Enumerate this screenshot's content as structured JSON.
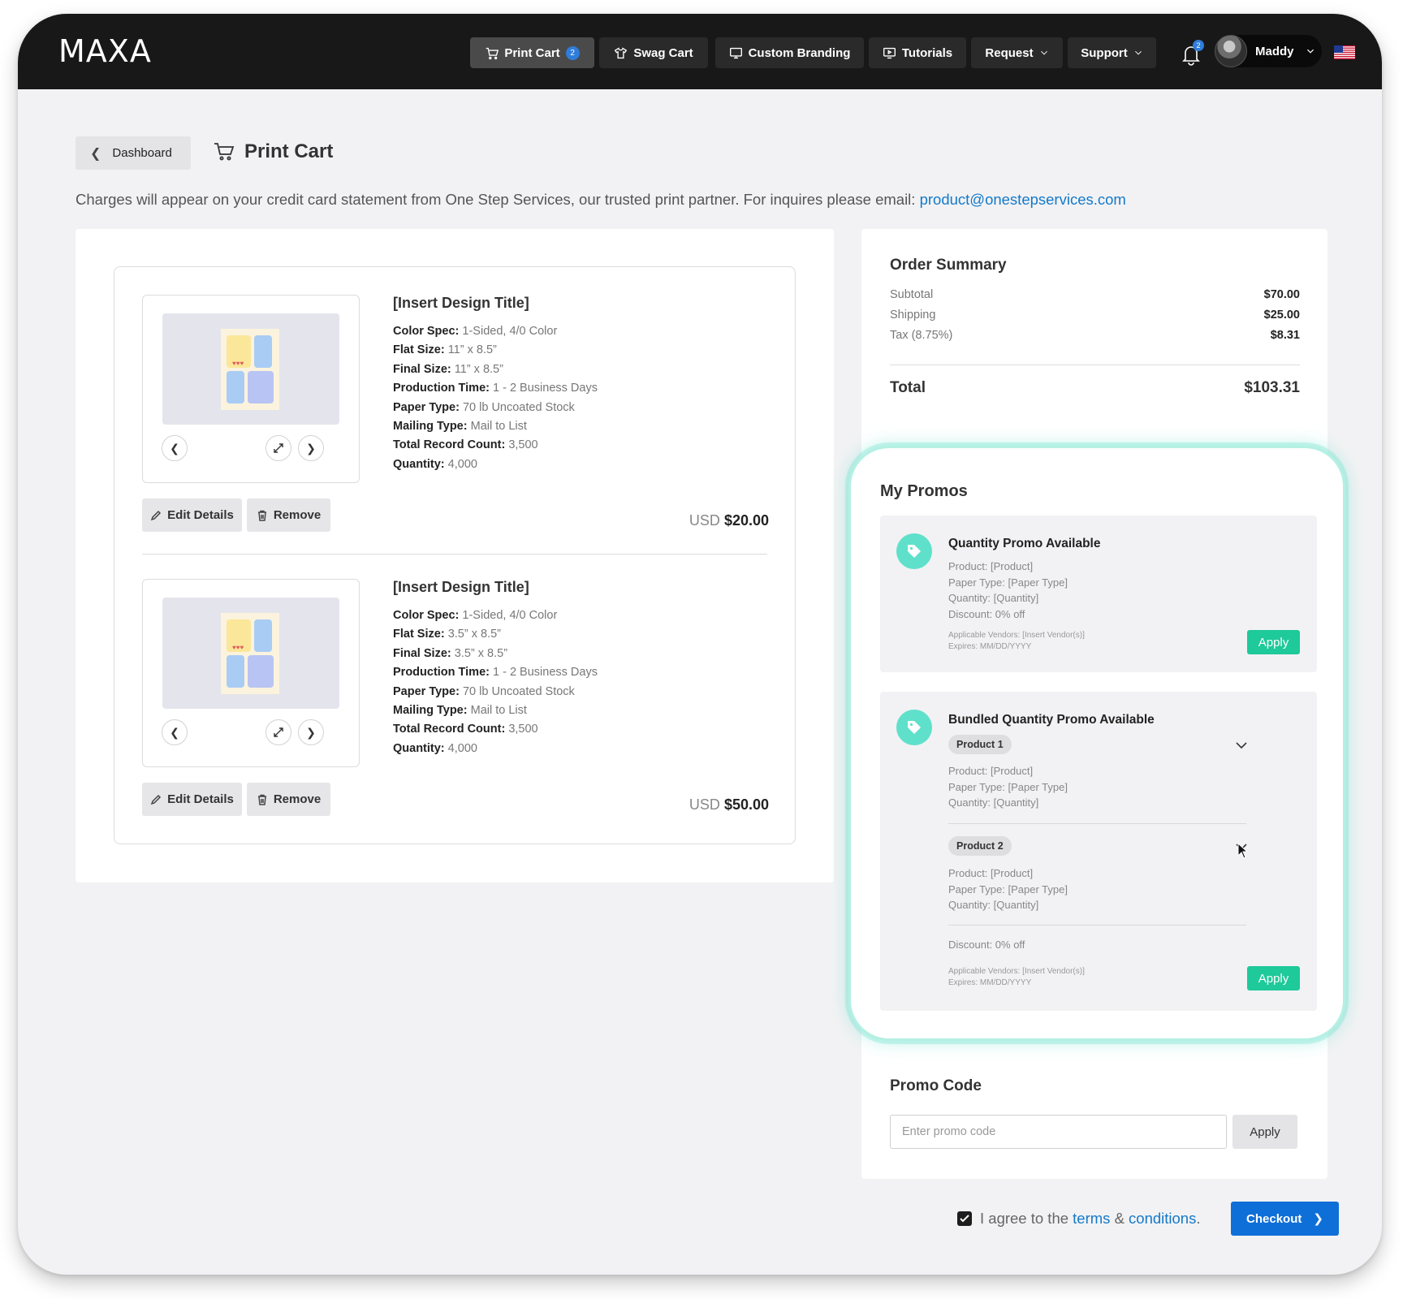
{
  "nav": {
    "logo": "MAXA",
    "items": [
      {
        "label": "Print Cart",
        "badge": "2",
        "icon": "cart-icon",
        "active": true
      },
      {
        "label": "Swag Cart",
        "icon": "shirt-icon"
      },
      {
        "label": "Custom Branding",
        "icon": "monitor-icon"
      },
      {
        "label": "Tutorials",
        "icon": "play-screen-icon"
      },
      {
        "label": "Request",
        "icon": "chevron-down-icon"
      },
      {
        "label": "Support",
        "icon": "chevron-down-icon"
      }
    ],
    "notification_count": "2",
    "user_name": "Maddy"
  },
  "header": {
    "back_label": "Dashboard",
    "title": "Print Cart",
    "notice": "Charges will appear on your credit card statement from One Step Services, our trusted print partner. For inquires please email: ",
    "notice_email": "product@onestepservices.com"
  },
  "cart": {
    "items": [
      {
        "title": "[Insert Design Title]",
        "specs": [
          {
            "label": "Color Spec:",
            "value": "1-Sided, 4/0 Color"
          },
          {
            "label": "Flat Size:",
            "value": "11” x 8.5”"
          },
          {
            "label": "Final Size:",
            "value": "11” x 8.5”"
          },
          {
            "label": "Production Time:",
            "value": "1 - 2 Business Days"
          },
          {
            "label": "Paper Type:",
            "value": "70 lb Uncoated Stock"
          },
          {
            "label": "Mailing Type:",
            "value": "Mail to List"
          },
          {
            "label": "Total Record Count:",
            "value": "3,500"
          },
          {
            "label": "Quantity:",
            "value": "4,000"
          }
        ],
        "currency": "USD",
        "price": "$20.00",
        "edit_label": "Edit Details",
        "remove_label": "Remove"
      },
      {
        "title": "[Insert Design Title]",
        "specs": [
          {
            "label": "Color Spec:",
            "value": "1-Sided, 4/0 Color"
          },
          {
            "label": "Flat Size:",
            "value": "3.5” x 8.5”"
          },
          {
            "label": "Final Size:",
            "value": "3.5” x 8.5”"
          },
          {
            "label": "Production Time:",
            "value": "1 - 2 Business Days"
          },
          {
            "label": "Paper Type:",
            "value": "70 lb Uncoated Stock"
          },
          {
            "label": "Mailing Type:",
            "value": "Mail to List"
          },
          {
            "label": "Total Record Count:",
            "value": "3,500"
          },
          {
            "label": "Quantity:",
            "value": "4,000"
          }
        ],
        "currency": "USD",
        "price": "$50.00",
        "edit_label": "Edit Details",
        "remove_label": "Remove"
      }
    ]
  },
  "summary": {
    "title": "Order Summary",
    "rows": [
      {
        "label": "Subtotal",
        "value": "$70.00"
      },
      {
        "label": "Shipping",
        "value": "$25.00"
      },
      {
        "label": "Tax (8.75%)",
        "value": "$8.31"
      }
    ],
    "total_label": "Total",
    "total_value": "$103.31"
  },
  "promos": {
    "title": "My Promos",
    "quantity": {
      "heading": "Quantity Promo Available",
      "lines": [
        "Product: [Product]",
        "Paper Type: [Paper Type]",
        "Quantity: [Quantity]",
        "Discount: 0% off"
      ],
      "vendors": "Applicable Vendors: [Insert Vendor(s)]",
      "expires": "Expires: MM/DD/YYYY",
      "apply_label": "Apply"
    },
    "bundled": {
      "heading": "Bundled Quantity Promo Available",
      "products": [
        {
          "chip": "Product 1",
          "lines": [
            "Product: [Product]",
            "Paper Type: [Paper Type]",
            "Quantity: [Quantity]"
          ]
        },
        {
          "chip": "Product 2",
          "lines": [
            "Product: [Product]",
            "Paper Type: [Paper Type]",
            "Quantity: [Quantity]"
          ]
        }
      ],
      "discount": "Discount: 0% off",
      "vendors": "Applicable Vendors: [Insert Vendor(s)]",
      "expires": "Expires: MM/DD/YYYY",
      "apply_label": "Apply"
    }
  },
  "promo_code": {
    "title": "Promo Code",
    "placeholder": "Enter promo code",
    "value": "",
    "apply_label": "Apply"
  },
  "footer": {
    "agree_prefix": "I agree to the",
    "terms": "terms",
    "amp": "&",
    "conditions": "conditions",
    "period": ".",
    "agree_checked": true,
    "checkout_label": "Checkout"
  },
  "colors": {
    "accent_blue": "#0f6fd8",
    "promo_green": "#1ec99a",
    "promo_glow": "#5fe0cb",
    "nav_bg": "#181818"
  }
}
